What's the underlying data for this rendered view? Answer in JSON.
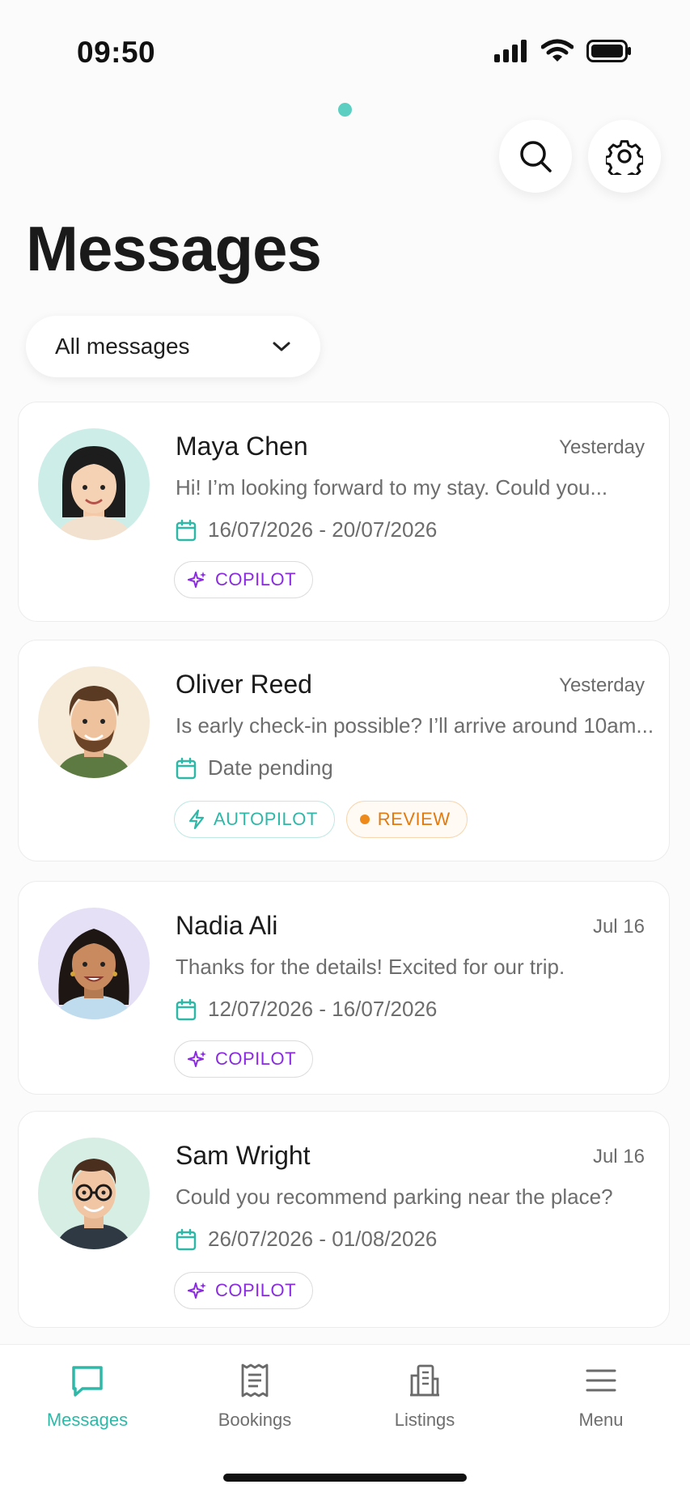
{
  "status_bar": {
    "time": "09:50"
  },
  "header": {
    "title": "Messages"
  },
  "filter": {
    "label": "All messages"
  },
  "messages": [
    {
      "name": "Maya Chen",
      "date": "Yesterday",
      "preview": "Hi! I’m looking forward to my stay. Could you...",
      "range": "16/07/2026 - 20/07/2026",
      "chips": [
        "COPILOT"
      ]
    },
    {
      "name": "Oliver Reed",
      "date": "Yesterday",
      "preview": "Is early check-in possible? I’ll arrive around 10am...",
      "range": "Date pending",
      "chips": [
        "AUTOPILOT",
        "REVIEW"
      ]
    },
    {
      "name": "Nadia Ali",
      "date": "Jul 16",
      "preview": "Thanks for the details! Excited for our trip.",
      "range": "12/07/2026 - 16/07/2026",
      "chips": [
        "COPILOT"
      ]
    },
    {
      "name": "Sam Wright",
      "date": "Jul 16",
      "preview": "Could you recommend parking near the place?",
      "range": "26/07/2026 - 01/08/2026",
      "chips": [
        "COPILOT"
      ]
    }
  ],
  "tabbar": {
    "tabs": [
      {
        "label": "Messages",
        "icon": "message-icon",
        "active": true
      },
      {
        "label": "Bookings",
        "icon": "receipt-icon",
        "active": false
      },
      {
        "label": "Listings",
        "icon": "building-icon",
        "active": false
      },
      {
        "label": "Menu",
        "icon": "menu-icon",
        "active": false
      }
    ]
  },
  "colors": {
    "accent": "#2fb8a8",
    "copilot": "#8a2be2",
    "review": "#e27a12"
  }
}
